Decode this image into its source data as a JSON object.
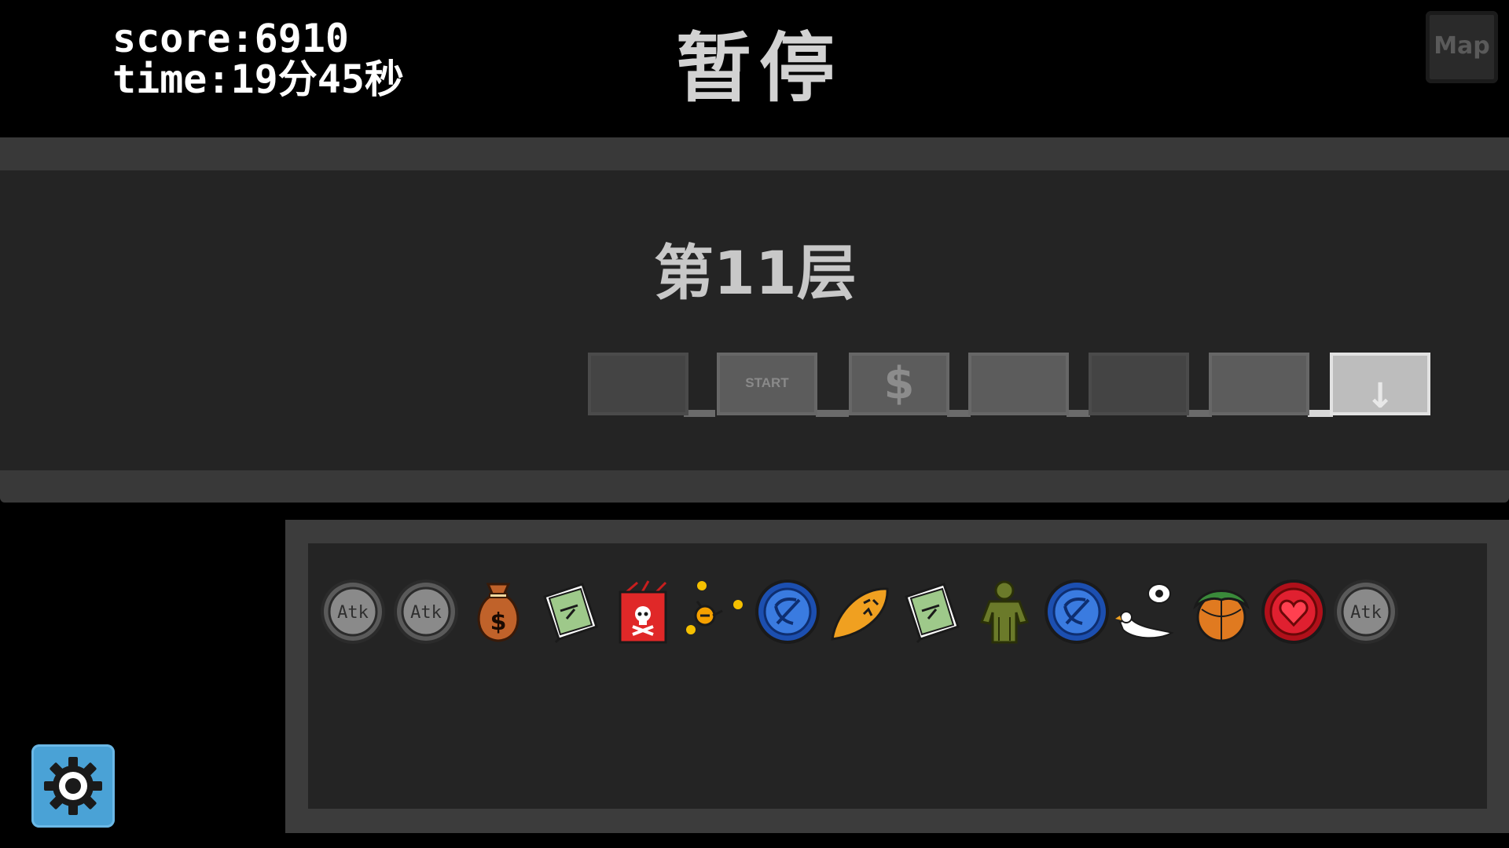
{
  "hud": {
    "score_text": "score:6910",
    "time_text": "time:19分45秒"
  },
  "header": {
    "title": "暂停"
  },
  "map_button": {
    "label": "Map"
  },
  "floor": {
    "label": "第11层",
    "rooms": [
      {
        "id": "room-1",
        "type": "empty",
        "shade": "dark"
      },
      {
        "id": "room-2",
        "type": "start",
        "label": "START",
        "shade": "mid"
      },
      {
        "id": "room-3",
        "type": "shop",
        "icon": "dollar-icon",
        "glyph": "$",
        "shade": "mid"
      },
      {
        "id": "room-4",
        "type": "empty",
        "shade": "mid"
      },
      {
        "id": "room-5",
        "type": "empty",
        "shade": "dark"
      },
      {
        "id": "room-6",
        "type": "empty",
        "shade": "mid"
      },
      {
        "id": "room-7",
        "type": "exit",
        "icon": "down-arrow-icon",
        "glyph": "↓",
        "shade": "light",
        "current": true
      }
    ]
  },
  "items": [
    {
      "name": "atk-coin-icon",
      "text": "Atk"
    },
    {
      "name": "atk-coin-icon",
      "text": "Atk"
    },
    {
      "name": "money-bag-icon"
    },
    {
      "name": "spell-book-icon"
    },
    {
      "name": "poison-box-icon"
    },
    {
      "name": "orbiting-dots-icon"
    },
    {
      "name": "bow-coin-icon"
    },
    {
      "name": "angry-leaf-icon"
    },
    {
      "name": "spell-book-icon"
    },
    {
      "name": "ghillie-figure-icon"
    },
    {
      "name": "bow-coin-icon"
    },
    {
      "name": "pigeon-icon"
    },
    {
      "name": "leafy-basketball-icon"
    },
    {
      "name": "heart-coin-icon"
    },
    {
      "name": "atk-coin-icon",
      "text": "Atk"
    }
  ],
  "settings_button": {
    "icon": "gear-icon"
  },
  "colors": {
    "background": "#000000",
    "panel": "#242424",
    "panel_border": "#393939",
    "settings_blue": "#4aa2d6",
    "current_room": "#bdbdbd"
  }
}
